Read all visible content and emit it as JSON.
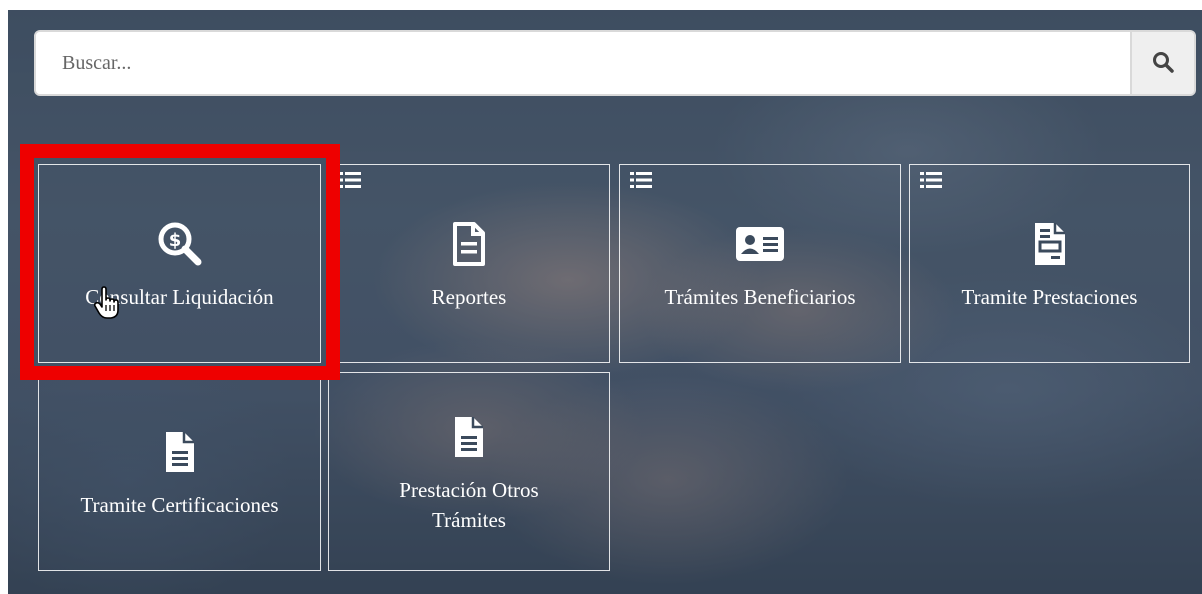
{
  "search": {
    "placeholder": "Buscar...",
    "button_icon": "search-icon"
  },
  "tiles": [
    {
      "label": "Consultar Liquidación",
      "icon": "search-dollar-icon",
      "has_menu": false,
      "highlighted": true
    },
    {
      "label": "Reportes",
      "icon": "file-text-icon",
      "has_menu": true
    },
    {
      "label": "Trámites Beneficiarios",
      "icon": "id-card-icon",
      "has_menu": true
    },
    {
      "label": "Tramite Prestaciones",
      "icon": "file-invoice-icon",
      "has_menu": true
    },
    {
      "label": "Tramite Certificaciones",
      "icon": "file-text-icon",
      "has_menu": false
    },
    {
      "label": "Prestación Otros Trámites",
      "icon": "file-text-icon",
      "has_menu": false
    }
  ],
  "colors": {
    "highlight": "#ee0000",
    "tile_border": "#ffffff",
    "text": "#ffffff"
  }
}
